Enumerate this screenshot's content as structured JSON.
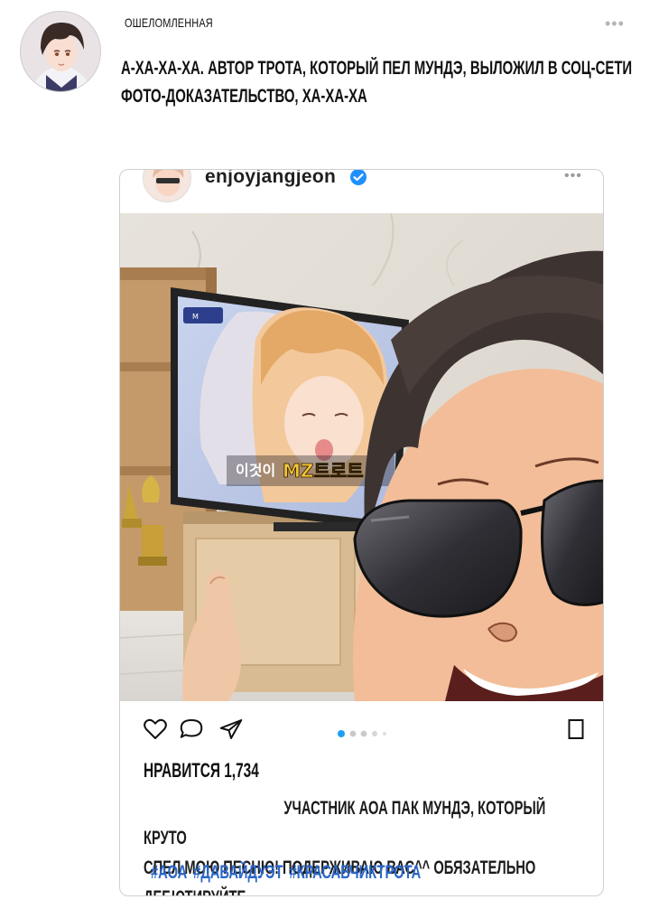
{
  "post": {
    "author": "ОШЕЛОМЛЕННАЯ",
    "text_line1": "А-ХА-ХА-ХА. АВТОР ТРОТА, КОТОРЫЙ ПЕЛ МУНДЭ, ВЫЛОЖИЛ В СОЦ-СЕТИ",
    "text_line2": "ФОТО-ДОКАЗАТЕЛЬСТВО, ХА-ХА-ХА",
    "menu_icon": "more-dots-icon"
  },
  "insta": {
    "handle": "enjoyjangjeon",
    "verified_icon": "verified-badge-icon",
    "menu_icon": "more-dots-icon",
    "photo": {
      "tv_caption_prefix": "이것이",
      "tv_caption_highlight": "MZ트로트"
    },
    "actions": {
      "like_icon": "heart-icon",
      "comment_icon": "comment-icon",
      "share_icon": "send-icon",
      "save_icon": "bookmark-icon",
      "active_page": 1,
      "page_count": 5
    },
    "likes": "НРАВИТСЯ 1,734",
    "caption_line1": "УЧАСТНИК АОА ПАК МУНДЭ, КОТОРЫЙ КРУТО",
    "caption_line2": "СПЕЛ МОЮ ПЕСНЮ! ПОДЕРЖИВАЮ ВАС^^ ОБЯЗАТЕЛЬНО ДЕБЮТИРУЙТЕ",
    "tags": [
      "#АОА",
      "#ДАВАЙДУЭТ",
      "#КРАСАВЧИКТРОТА"
    ],
    "colors": {
      "accent": "#1da1f2",
      "hashtag": "#2a66c9",
      "verified": "#1e90ff"
    }
  }
}
